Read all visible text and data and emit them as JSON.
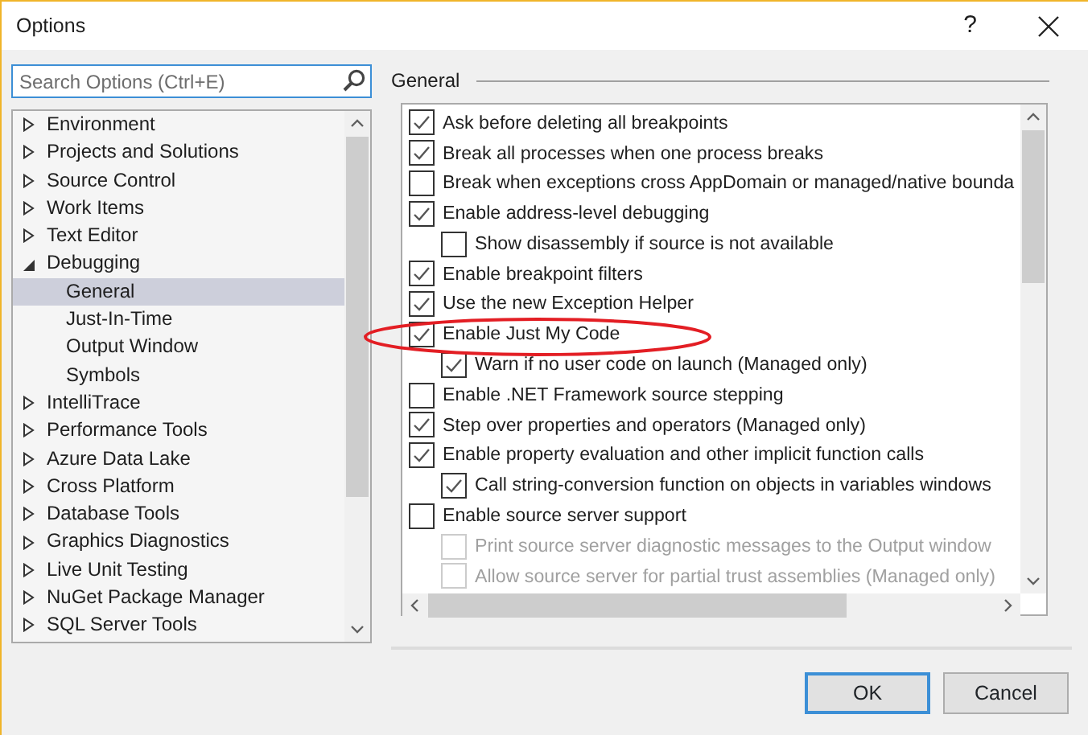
{
  "window": {
    "title": "Options",
    "help": "?"
  },
  "search": {
    "placeholder": "Search Options (Ctrl+E)"
  },
  "tree": [
    {
      "label": "Environment",
      "expanded": false,
      "selected": false
    },
    {
      "label": "Projects and Solutions",
      "expanded": false,
      "selected": false
    },
    {
      "label": "Source Control",
      "expanded": false,
      "selected": false
    },
    {
      "label": "Work Items",
      "expanded": false,
      "selected": false
    },
    {
      "label": "Text Editor",
      "expanded": false,
      "selected": false
    },
    {
      "label": "Debugging",
      "expanded": true,
      "selected": false,
      "children": [
        {
          "label": "General",
          "selected": true
        },
        {
          "label": "Just-In-Time",
          "selected": false
        },
        {
          "label": "Output Window",
          "selected": false
        },
        {
          "label": "Symbols",
          "selected": false
        }
      ]
    },
    {
      "label": "IntelliTrace",
      "expanded": false,
      "selected": false
    },
    {
      "label": "Performance Tools",
      "expanded": false,
      "selected": false
    },
    {
      "label": "Azure Data Lake",
      "expanded": false,
      "selected": false
    },
    {
      "label": "Cross Platform",
      "expanded": false,
      "selected": false
    },
    {
      "label": "Database Tools",
      "expanded": false,
      "selected": false
    },
    {
      "label": "Graphics Diagnostics",
      "expanded": false,
      "selected": false
    },
    {
      "label": "Live Unit Testing",
      "expanded": false,
      "selected": false
    },
    {
      "label": "NuGet Package Manager",
      "expanded": false,
      "selected": false
    },
    {
      "label": "SQL Server Tools",
      "expanded": false,
      "selected": false
    }
  ],
  "section": {
    "title": "General"
  },
  "options": [
    {
      "label": "Ask before deleting all breakpoints",
      "checked": true,
      "disabled": false
    },
    {
      "label": "Break all processes when one process breaks",
      "checked": true,
      "disabled": false
    },
    {
      "label": "Break when exceptions cross AppDomain or managed/native bounda",
      "checked": false,
      "disabled": false
    },
    {
      "label": "Enable address-level debugging",
      "checked": true,
      "disabled": false,
      "children": [
        {
          "label": "Show disassembly if source is not available",
          "checked": false,
          "disabled": false
        }
      ]
    },
    {
      "label": "Enable breakpoint filters",
      "checked": true,
      "disabled": false
    },
    {
      "label": "Use the new Exception Helper",
      "checked": true,
      "disabled": false
    },
    {
      "label": "Enable Just My Code",
      "checked": true,
      "disabled": false,
      "children": [
        {
          "label": "Warn if no user code on launch (Managed only)",
          "checked": true,
          "disabled": false
        }
      ]
    },
    {
      "label": "Enable .NET Framework source stepping",
      "checked": false,
      "disabled": false
    },
    {
      "label": "Step over properties and operators (Managed only)",
      "checked": true,
      "disabled": false
    },
    {
      "label": "Enable property evaluation and other implicit function calls",
      "checked": true,
      "disabled": false,
      "children": [
        {
          "label": "Call string-conversion function on objects in variables windows",
          "checked": true,
          "disabled": false
        }
      ]
    },
    {
      "label": "Enable source server support",
      "checked": false,
      "disabled": false,
      "children": [
        {
          "label": "Print source server diagnostic messages to the Output window",
          "checked": false,
          "disabled": true
        },
        {
          "label": "Allow source server for partial trust assemblies (Managed only)",
          "checked": false,
          "disabled": true
        }
      ]
    }
  ],
  "buttons": [
    {
      "label": "OK",
      "default": true
    },
    {
      "label": "Cancel",
      "default": false
    }
  ]
}
